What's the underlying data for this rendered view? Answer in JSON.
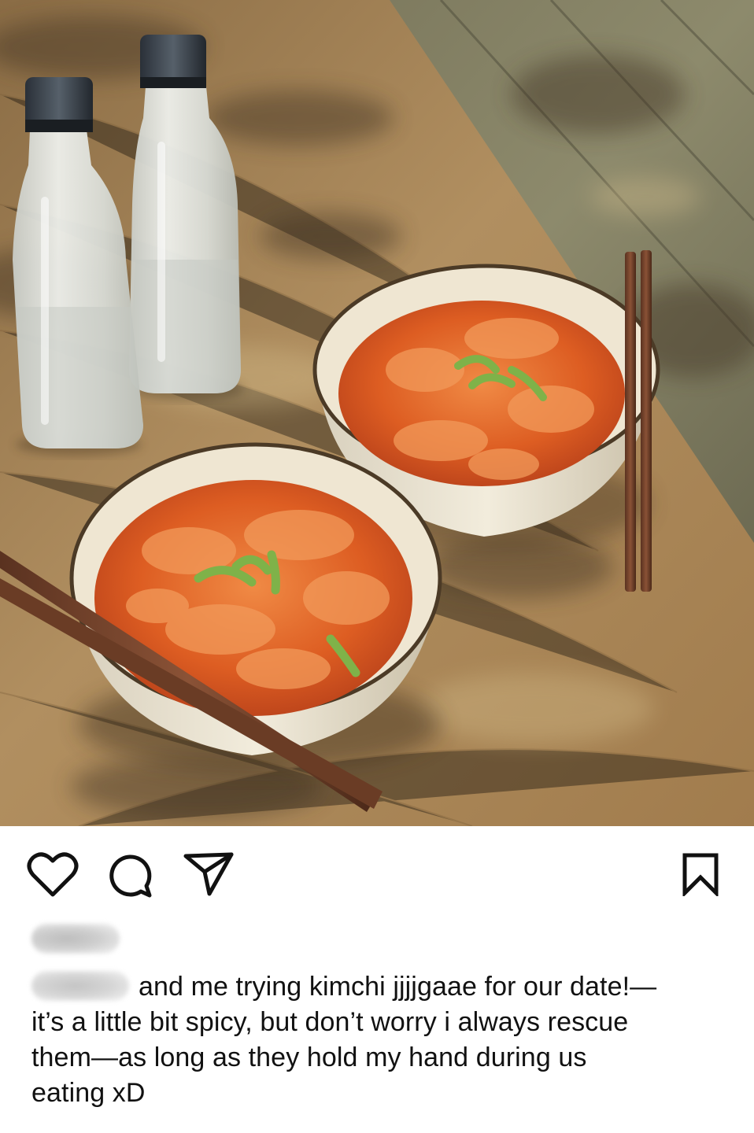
{
  "post": {
    "image": {
      "alt_subject": "two bowls of kimchi stew with chopsticks and two water bottles on a wooden table"
    },
    "actions": {
      "like_icon": "heart-icon",
      "comment_icon": "comment-bubble-icon",
      "share_icon": "paper-plane-icon",
      "save_icon": "bookmark-icon"
    },
    "likes": {
      "blurred": true
    },
    "caption": {
      "username_blurred": true,
      "lines": [
        "and me trying kimchi jjjjgaae for our date!—",
        "it’s a little bit spicy, but don’t worry i always rescue",
        "them—as long as they hold my hand during us",
        "eating xD"
      ]
    },
    "colors": {
      "background": "#ffffff",
      "text": "#111111",
      "icon": "#111111",
      "stew": "#d9541e",
      "table": "#a8875a"
    }
  }
}
